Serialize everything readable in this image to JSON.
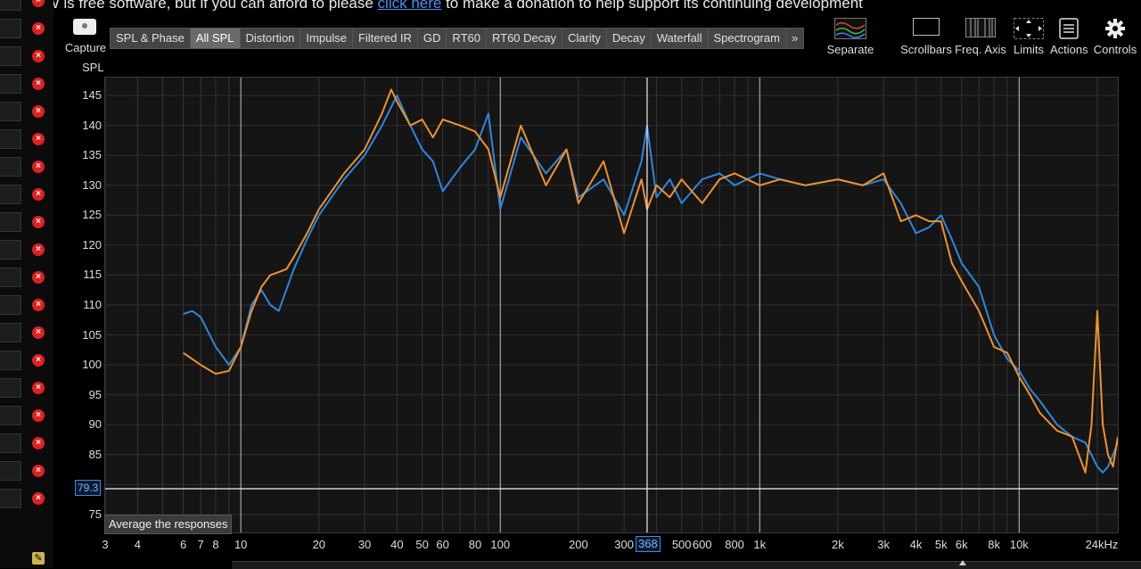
{
  "banner": {
    "text_before": "REW is free software, but if you can afford to please ",
    "link_text": "click here",
    "text_after": " to make a donation to help support its continuing development"
  },
  "toolbar": {
    "capture_label": "Capture",
    "tabs": [
      {
        "label": "SPL & Phase",
        "active": false
      },
      {
        "label": "All SPL",
        "active": true
      },
      {
        "label": "Distortion",
        "active": false
      },
      {
        "label": "Impulse",
        "active": false
      },
      {
        "label": "Filtered IR",
        "active": false
      },
      {
        "label": "GD",
        "active": false
      },
      {
        "label": "RT60",
        "active": false
      },
      {
        "label": "RT60 Decay",
        "active": false
      },
      {
        "label": "Clarity",
        "active": false
      },
      {
        "label": "Decay",
        "active": false
      },
      {
        "label": "Waterfall",
        "active": false
      },
      {
        "label": "Spectrogram",
        "active": false
      }
    ],
    "more_label": "»",
    "tools": [
      {
        "label": "Separate",
        "icon": "separate-icon"
      },
      {
        "label": "Scrollbars",
        "icon": "scrollbars-icon"
      },
      {
        "label": "Freq. Axis",
        "icon": "freq-axis-icon"
      },
      {
        "label": "Limits",
        "icon": "limits-icon"
      },
      {
        "label": "Actions",
        "icon": "actions-icon"
      },
      {
        "label": "Controls",
        "icon": "gear-icon"
      }
    ]
  },
  "measurement_list": {
    "row_count": 19,
    "remove_icon": "close-icon"
  },
  "plot": {
    "y_axis_title": "SPL",
    "cursor_x_value": "368",
    "cursor_y_value": "79.3",
    "average_button_label": "Average the responses"
  },
  "chart_data": {
    "type": "line",
    "title": "",
    "ylabel": "SPL",
    "xlabel": "",
    "x_scale": "log",
    "xlim": [
      3,
      24000
    ],
    "ylim": [
      72,
      148
    ],
    "grid": true,
    "y_ticks": [
      75,
      80,
      85,
      90,
      95,
      100,
      105,
      110,
      115,
      120,
      125,
      130,
      135,
      140,
      145
    ],
    "y_tick_labels": [
      "75",
      "",
      "85",
      "90",
      "95",
      "100",
      "105",
      "110",
      "115",
      "120",
      "125",
      "130",
      "135",
      "140",
      "145"
    ],
    "x_tick_labels": [
      {
        "v": 3,
        "t": "3"
      },
      {
        "v": 4,
        "t": "4"
      },
      {
        "v": 6,
        "t": "6"
      },
      {
        "v": 7,
        "t": "7"
      },
      {
        "v": 8,
        "t": "8"
      },
      {
        "v": 10,
        "t": "10"
      },
      {
        "v": 20,
        "t": "20"
      },
      {
        "v": 30,
        "t": "30"
      },
      {
        "v": 40,
        "t": "40"
      },
      {
        "v": 50,
        "t": "50"
      },
      {
        "v": 60,
        "t": "60"
      },
      {
        "v": 80,
        "t": "80"
      },
      {
        "v": 100,
        "t": "100"
      },
      {
        "v": 200,
        "t": "200"
      },
      {
        "v": 300,
        "t": "300"
      },
      {
        "v": 500,
        "t": "500"
      },
      {
        "v": 600,
        "t": "600"
      },
      {
        "v": 800,
        "t": "800"
      },
      {
        "v": 1000,
        "t": "1k"
      },
      {
        "v": 2000,
        "t": "2k"
      },
      {
        "v": 3000,
        "t": "3k"
      },
      {
        "v": 4000,
        "t": "4k"
      },
      {
        "v": 5000,
        "t": "5k"
      },
      {
        "v": 6000,
        "t": "6k"
      },
      {
        "v": 8000,
        "t": "8k"
      },
      {
        "v": 10000,
        "t": "10k"
      },
      {
        "v": 24000,
        "t": "24kHz"
      }
    ],
    "major_gridlines_x": [
      10,
      100,
      1000,
      10000
    ],
    "cursor": {
      "x": 368,
      "y": 79.3
    },
    "series": [
      {
        "color": "#2f86e0",
        "x": [
          6,
          6.5,
          7,
          8,
          9,
          10,
          11,
          12,
          13,
          14,
          16,
          18,
          20,
          25,
          30,
          35,
          40,
          45,
          50,
          55,
          60,
          70,
          80,
          90,
          100,
          120,
          150,
          180,
          200,
          250,
          300,
          350,
          368,
          400,
          450,
          500,
          600,
          700,
          800,
          1000,
          1200,
          1500,
          2000,
          2500,
          3000,
          3500,
          4000,
          4500,
          5000,
          5500,
          6000,
          7000,
          8000,
          9000,
          10000,
          11000,
          12000,
          14000,
          16000,
          18000,
          20000,
          21000,
          22000,
          23000,
          24000
        ],
        "y": [
          108.5,
          109,
          108,
          103,
          100,
          103,
          110,
          112.5,
          110,
          109,
          116,
          121,
          125,
          131,
          135,
          140,
          145,
          140,
          136,
          134,
          129,
          133,
          136,
          142,
          126,
          138,
          132,
          136,
          128,
          131,
          125,
          134,
          140,
          128,
          131,
          127,
          131,
          132,
          130,
          132,
          131,
          130,
          131,
          130,
          131,
          127,
          122,
          123,
          125,
          121,
          117,
          113,
          105,
          101,
          99,
          96,
          94,
          90,
          88,
          87,
          83,
          82,
          83,
          85,
          87
        ]
      },
      {
        "color": "#f0922a",
        "x": [
          6,
          7,
          8,
          9,
          10,
          11,
          12,
          13,
          14,
          15,
          16,
          18,
          20,
          25,
          30,
          35,
          38,
          40,
          45,
          50,
          55,
          60,
          70,
          80,
          90,
          100,
          120,
          150,
          180,
          200,
          250,
          300,
          350,
          368,
          400,
          450,
          500,
          600,
          700,
          800,
          1000,
          1200,
          1500,
          2000,
          2500,
          3000,
          3500,
          4000,
          4500,
          5000,
          5500,
          6000,
          7000,
          8000,
          9000,
          10000,
          11000,
          12000,
          14000,
          16000,
          18000,
          19000,
          20000,
          21000,
          22000,
          23000,
          24000
        ],
        "y": [
          102,
          100,
          98.5,
          99,
          103,
          109,
          113,
          115,
          115.5,
          116,
          118,
          122,
          126,
          132,
          136,
          142,
          146,
          144,
          140,
          141,
          138,
          141,
          140,
          139,
          136,
          128,
          140,
          130,
          136,
          127,
          134,
          122,
          131,
          126,
          130,
          128,
          131,
          127,
          131,
          132,
          130,
          131,
          130,
          131,
          130,
          132,
          124,
          125,
          124,
          124,
          117,
          114,
          109,
          103,
          102,
          98,
          95,
          92,
          89,
          88,
          82,
          90,
          109,
          90,
          85,
          83,
          88
        ]
      }
    ]
  }
}
